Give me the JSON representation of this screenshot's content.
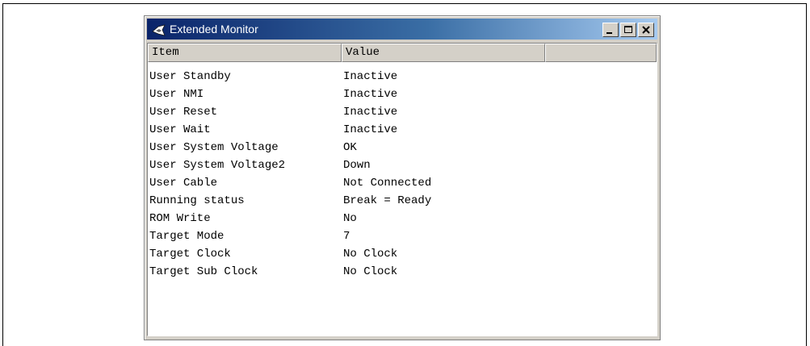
{
  "window": {
    "title": "Extended Monitor"
  },
  "columns": {
    "item": "Item",
    "value": "Value"
  },
  "rows": [
    {
      "item": "User Standby",
      "value": "Inactive"
    },
    {
      "item": "User NMI",
      "value": "Inactive"
    },
    {
      "item": "User Reset",
      "value": "Inactive"
    },
    {
      "item": "User Wait",
      "value": "Inactive"
    },
    {
      "item": "User System Voltage",
      "value": "OK"
    },
    {
      "item": "User System Voltage2",
      "value": "Down"
    },
    {
      "item": "User Cable",
      "value": "Not Connected"
    },
    {
      "item": "Running status",
      "value": "Break = Ready"
    },
    {
      "item": "ROM Write",
      "value": "No"
    },
    {
      "item": "Target Mode",
      "value": "7"
    },
    {
      "item": "Target Clock",
      "value": "No Clock"
    },
    {
      "item": "Target Sub Clock",
      "value": "No Clock"
    }
  ],
  "icons": {
    "app": "app-icon",
    "minimize": "minimize-icon",
    "maximize": "maximize-icon",
    "close": "close-icon"
  },
  "colors": {
    "titlebar_start": "#0a246a",
    "titlebar_end": "#a6caf0",
    "face": "#d4d0c8"
  }
}
